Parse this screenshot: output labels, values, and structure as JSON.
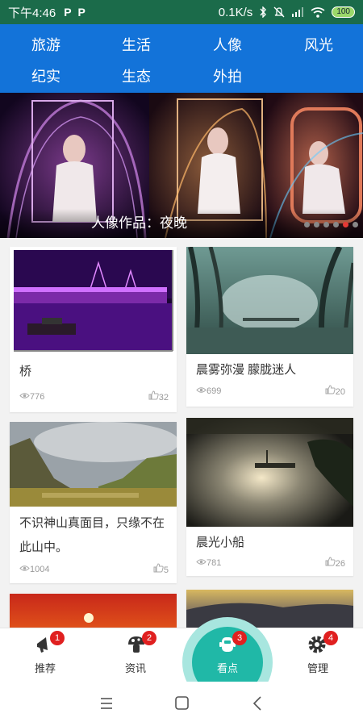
{
  "status_bar": {
    "time": "下午4:46",
    "notif_icons": [
      "P",
      "P"
    ],
    "network_speed": "0.1K/s",
    "battery": "100"
  },
  "category_nav": {
    "items": [
      "旅游",
      "生活",
      "人像",
      "风光",
      "纪实",
      "生态",
      "外拍"
    ]
  },
  "banner": {
    "caption": "人像作品：夜晚",
    "dot_count": 6,
    "active_dot": 5
  },
  "cards": [
    {
      "title": "桥",
      "views": "776",
      "likes": "32"
    },
    {
      "title": "晨雾弥漫  朦胧迷人",
      "views": "699",
      "likes": "20"
    },
    {
      "title": "不识神山真面目，只缘不在此山中。",
      "views": "1004",
      "likes": "5"
    },
    {
      "title": "晨光小船",
      "views": "781",
      "likes": "26"
    }
  ],
  "tabs": [
    {
      "label": "推荐",
      "badge": "1",
      "icon": "megaphone-icon"
    },
    {
      "label": "资讯",
      "badge": "2",
      "icon": "mushroom-icon"
    },
    {
      "label": "看点",
      "badge": "3",
      "icon": "eye-icon"
    },
    {
      "label": "管理",
      "badge": "4",
      "icon": "gear-icon"
    }
  ],
  "colors": {
    "status_bar": "#1b6b4a",
    "category_nav": "#1373d9",
    "center_tab": "#20b8a7",
    "badge": "#e02020"
  }
}
